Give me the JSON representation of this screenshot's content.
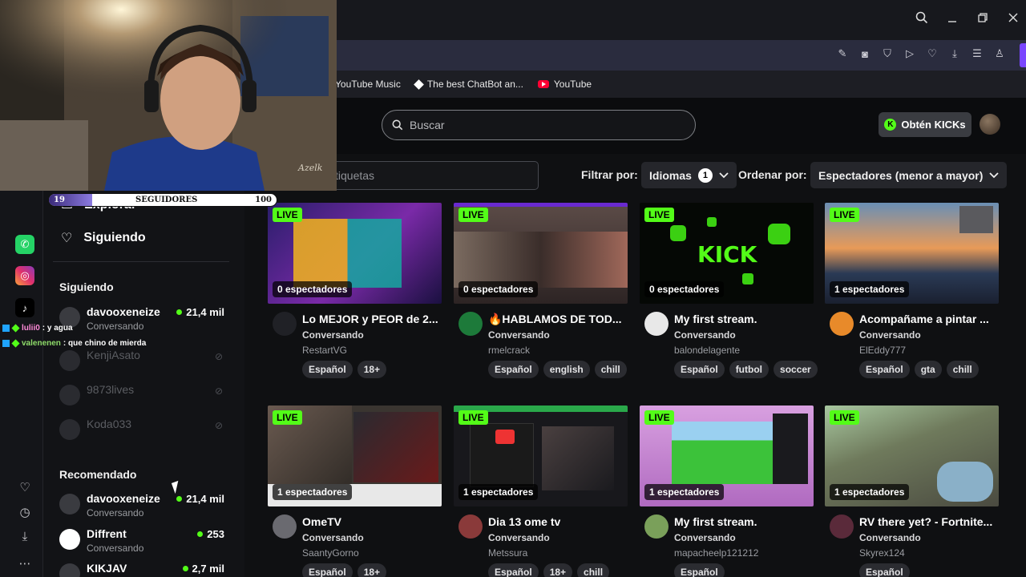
{
  "bookmarks": [
    {
      "label": "YouTube Music",
      "icon": "youtube-music-icon"
    },
    {
      "label": "The best ChatBot an...",
      "icon": "diamond-icon"
    },
    {
      "label": "YouTube",
      "icon": "youtube-icon"
    }
  ],
  "header": {
    "search_placeholder": "Buscar",
    "kicks_button": "Obtén KICKs",
    "kicks_symbol": "K"
  },
  "filters": {
    "tags_placeholder": "tiquetas",
    "filter_by_label": "Filtrar por:",
    "languages_label": "Idiomas",
    "languages_count": "1",
    "sort_by_label": "Ordenar por:",
    "sort_value": "Espectadores (menor a mayor)"
  },
  "sidebar": {
    "explore": "Explorar",
    "following_nav": "Siguiendo",
    "following_section": "Siguiendo",
    "following": [
      {
        "name": "davooxeneize",
        "sub": "Conversando",
        "viewers": "21,4 mil",
        "live": true
      },
      {
        "name": "KenjiAsato",
        "sub": "",
        "viewers": "",
        "live": false
      },
      {
        "name": "9873lives",
        "sub": "",
        "viewers": "",
        "live": false
      },
      {
        "name": "Koda033",
        "sub": "",
        "viewers": "",
        "live": false
      }
    ],
    "recommended_section": "Recomendado",
    "recommended": [
      {
        "name": "davooxeneize",
        "sub": "Conversando",
        "viewers": "21,4 mil"
      },
      {
        "name": "Diffrent",
        "sub": "Conversando",
        "viewers": "253"
      },
      {
        "name": "KIKJAV",
        "sub": "",
        "viewers": "2,7 mil"
      }
    ]
  },
  "streams": [
    {
      "live": "LIVE",
      "viewers": "0 espectadores",
      "title": "Lo MEJOR y PEOR de 2...",
      "category": "Conversando",
      "user": "RestartVG",
      "tags": [
        "Español",
        "18+"
      ],
      "thumb_color": "#1b2a6b"
    },
    {
      "live": "LIVE",
      "viewers": "0 espectadores",
      "title": "🔥HABLAMOS DE TOD...",
      "category": "Conversando",
      "user": "rmelcrack",
      "tags": [
        "Español",
        "english",
        "chill"
      ],
      "thumb_color": "#4a3b3a"
    },
    {
      "live": "LIVE",
      "viewers": "0 espectadores",
      "title": "My first stream.",
      "category": "Conversando",
      "user": "balondelagente",
      "tags": [
        "Español",
        "futbol",
        "soccer"
      ],
      "thumb_color": "#050a05"
    },
    {
      "live": "LIVE",
      "viewers": "1 espectadores",
      "title": "Acompañame a pintar ...",
      "category": "Conversando",
      "user": "ElEddy777",
      "tags": [
        "Español",
        "gta",
        "chill"
      ],
      "thumb_color": "#2c3f5a"
    },
    {
      "live": "LIVE",
      "viewers": "1 espectadores",
      "title": "OmeTV",
      "category": "Conversando",
      "user": "SaantyGorno",
      "tags": [
        "Español",
        "18+"
      ],
      "thumb_color": "#3a3530"
    },
    {
      "live": "LIVE",
      "viewers": "1 espectadores",
      "title": "Dia 13 ome tv",
      "category": "Conversando",
      "user": "Metssura",
      "tags": [
        "Español",
        "18+",
        "chill"
      ],
      "thumb_color": "#1a1a1e"
    },
    {
      "live": "LIVE",
      "viewers": "1 espectadores",
      "title": "My first stream.",
      "category": "Conversando",
      "user": "mapacheelp121212",
      "tags": [
        "Español"
      ],
      "thumb_color": "#c98fd6"
    },
    {
      "live": "LIVE",
      "viewers": "1 espectadores",
      "title": "RV there yet? - Fortnite...",
      "category": "Conversando",
      "user": "Skyrex124",
      "tags": [
        "Español"
      ],
      "thumb_color": "#6f7a5c"
    }
  ],
  "overlay": {
    "followers_label": "SEGUIDORES",
    "followers_current": "19",
    "followers_goal": "100",
    "followers_progress": 0.19,
    "chat": [
      {
        "user": "lulii0",
        "text": ": y agua",
        "color": "#ff8ad8"
      },
      {
        "user": "valenenen",
        "text": ": que chino de mierda",
        "color": "#8fdc6a"
      }
    ],
    "watermark": "Azelk"
  },
  "colors": {
    "accent": "#53fc18",
    "bg": "#0f1012",
    "bookmark_accent": "#7a46ff"
  }
}
